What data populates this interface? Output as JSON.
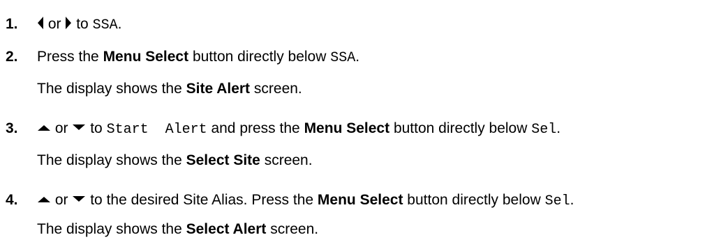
{
  "steps": [
    {
      "number": "1.",
      "line1": {
        "left_icon": "left-arrow-icon",
        "or": "or",
        "right_icon": "right-arrow-icon",
        "text": "to",
        "code": "SSA",
        "end": "."
      }
    },
    {
      "number": "2.",
      "line1": {
        "text1": "Press the",
        "bold": "Menu Select",
        "text2": "button directly below",
        "code": "SSA",
        "end": "."
      },
      "line2": {
        "text1": "The display shows the",
        "bold": "Site Alert",
        "text2": "screen."
      }
    },
    {
      "number": "3.",
      "line1": {
        "up_icon": "up-arrow-icon",
        "or": "or",
        "down_icon": "down-arrow-icon",
        "text1": "to",
        "code1": "Start  Alert",
        "text2": "and press the",
        "bold": "Menu Select",
        "text3": "button directly below",
        "code2": "Sel",
        "end": "."
      },
      "line2": {
        "text1": "The display shows the",
        "bold": "Select Site",
        "text2": "screen."
      }
    },
    {
      "number": "4.",
      "line1": {
        "up_icon": "up-arrow-icon",
        "or": "or",
        "down_icon": "down-arrow-icon",
        "text1": "to the desired Site Alias. Press the",
        "bold": "Menu Select",
        "text2": "button directly below",
        "code": "Sel",
        "end": "."
      },
      "line2": {
        "text1": "The display shows the",
        "bold": "Select Alert",
        "text2": "screen."
      }
    }
  ]
}
